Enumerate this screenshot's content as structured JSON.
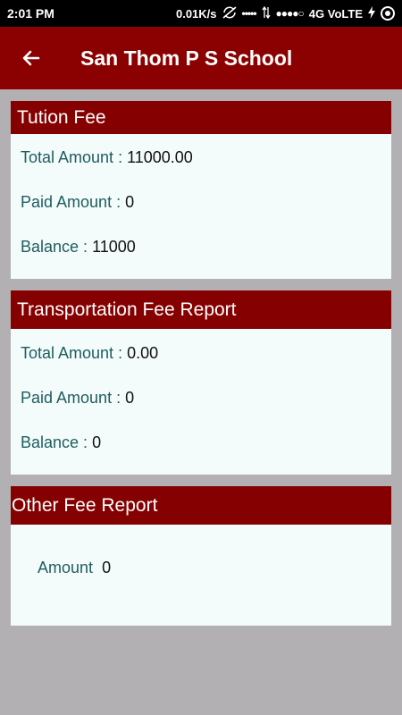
{
  "status_bar": {
    "time": "2:01 PM",
    "speed": "0.01K/s",
    "signal_dots": "•••••",
    "network_dots": "●●●●○",
    "network": "4G VoLTE"
  },
  "app_bar": {
    "title": "San Thom P S School"
  },
  "tution": {
    "title": "Tution Fee",
    "total_label": "Total Amount : ",
    "total_value": "11000.00",
    "paid_label": "Paid Amount : ",
    "paid_value": "0",
    "balance_label": "Balance : ",
    "balance_value": "11000"
  },
  "transport": {
    "title": "Transportation Fee Report",
    "total_label": "Total Amount : ",
    "total_value": "0.00",
    "paid_label": "Paid Amount : ",
    "paid_value": "0",
    "balance_label": "Balance : ",
    "balance_value": "0"
  },
  "other": {
    "title": "Other Fee Report",
    "amount_label": "Amount  ",
    "amount_value": "0"
  }
}
